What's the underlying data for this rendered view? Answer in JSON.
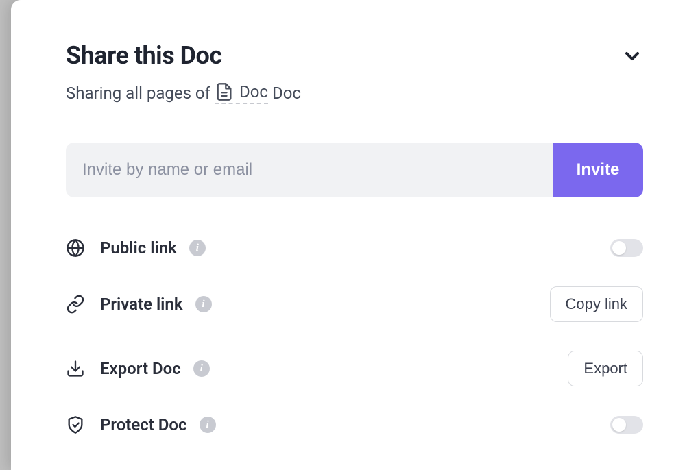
{
  "header": {
    "title": "Share this Doc",
    "subtitle_prefix": "Sharing all pages of",
    "doc_label": "Doc",
    "doc_name": "Doc"
  },
  "invite": {
    "placeholder": "Invite by name or email",
    "button_label": "Invite"
  },
  "options": {
    "public_link": {
      "label": "Public link",
      "enabled": false
    },
    "private_link": {
      "label": "Private link",
      "button_label": "Copy link"
    },
    "export_doc": {
      "label": "Export Doc",
      "button_label": "Export"
    },
    "protect_doc": {
      "label": "Protect Doc",
      "enabled": false
    }
  }
}
